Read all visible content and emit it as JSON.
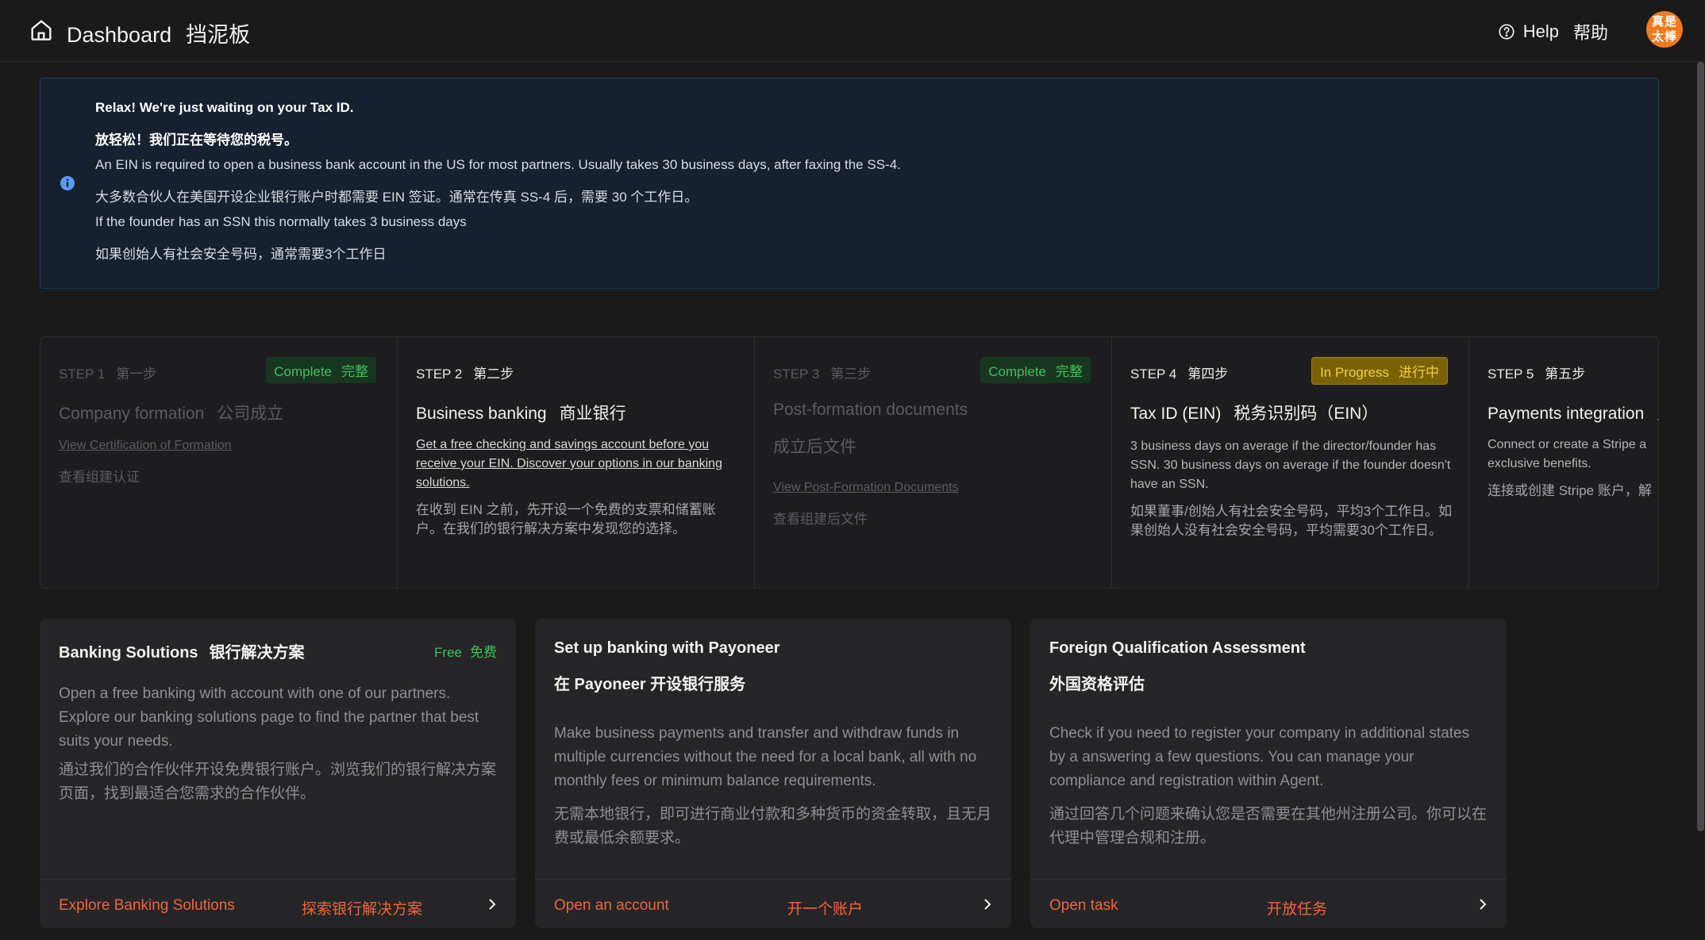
{
  "header": {
    "title": "Dashboard",
    "title_cn": "挡泥板",
    "help": "Help",
    "help_cn": "帮助",
    "avatar_line1": "真是",
    "avatar_line2": "太棒",
    "avatar_color": "#ee7a1e"
  },
  "banner": {
    "heading": "Relax! We're just waiting on your Tax ID.",
    "heading_cn": "放轻松！我们正在等待您的税号。",
    "line1": "An EIN is required to open a business bank account in the US for most partners. Usually takes 30 business days, after faxing the SS-4.",
    "line1_cn": "大多数合伙人在美国开设企业银行账户时都需要 EIN 签证。通常在传真 SS-4 后，需要 30 个工作日。",
    "line2": "If the founder has an SSN this normally takes 3 business days",
    "line2_cn": "如果创始人有社会安全号码，通常需要3个工作日",
    "icon": "info-icon"
  },
  "steps": [
    {
      "num": "STEP 1",
      "num_cn": "第一步",
      "badge": "Complete",
      "badge_cn": "完整",
      "title": "Company formation",
      "title_cn": "公司成立",
      "link": "View Certification of Formation",
      "link_cn": "查看组建认证"
    },
    {
      "num": "STEP 2",
      "num_cn": "第二步",
      "title": "Business banking",
      "title_cn": "商业银行",
      "body": "Get a free checking and savings account before you receive your EIN. Discover your options in our banking solutions.",
      "body_cn": "在收到 EIN 之前，先开设一个免费的支票和储蓄账户。在我们的银行解决方案中发现您的选择。"
    },
    {
      "num": "STEP 3",
      "num_cn": "第三步",
      "badge": "Complete",
      "badge_cn": "完整",
      "title": "Post-formation documents",
      "title_cn": "成立后文件",
      "link": "View Post-Formation Documents",
      "link_cn": "查看组建后文件"
    },
    {
      "num": "STEP 4",
      "num_cn": "第四步",
      "badge": "In Progress",
      "badge_cn": "进行中",
      "title": "Tax ID (EIN)",
      "title_cn": "税务识别码（EIN）",
      "body": "3 business days on average if the director/founder has SSN. 30 business days on average if the founder doesn't have an SSN.",
      "body_cn": "如果董事/创始人有社会安全号码，平均3个工作日。如果创始人没有社会安全号码，平均需要30个工作日。"
    },
    {
      "num": "STEP 5",
      "num_cn": "第五步",
      "title": "Payments integration",
      "title_cn": "支",
      "body": "Connect or create a Stripe a exclusive benefits.",
      "body_cn": "连接或创建 Stripe 账户，解"
    }
  ],
  "cards": [
    {
      "title": "Banking Solutions",
      "title_cn": "银行解决方案",
      "free": "Free",
      "free_cn": "免费",
      "desc": "Open a free banking with account with one of our partners. Explore our banking solutions page to find the partner that best suits your needs.",
      "desc_cn": "通过我们的合作伙伴开设免费银行账户。浏览我们的银行解决方案页面，找到最适合您需求的合作伙伴。",
      "cta": "Explore Banking Solutions",
      "cta_cn": "探索银行解决方案"
    },
    {
      "title": "Set up banking with Payoneer",
      "title_cn": "在 Payoneer 开设银行服务",
      "desc": "Make business payments and transfer and withdraw funds in multiple currencies without the need for a local bank, all with no monthly fees or minimum balance requirements.",
      "desc_cn": "无需本地银行，即可进行商业付款和多种货币的资金转取，且无月费或最低余额要求。",
      "cta": "Open an account",
      "cta_cn": "开一个账户"
    },
    {
      "title": "Foreign Qualification Assessment",
      "title_cn": "外国资格评估",
      "desc": "Check if you need to register your company in additional states by a answering a few questions. You can manage your compliance and registration within Agent.",
      "desc_cn": "通过回答几个问题来确认您是否需要在其他州注册公司。你可以在代理中管理合规和注册。",
      "cta": "Open task",
      "cta_cn": "开放任务"
    }
  ],
  "colors": {
    "accent": "#f2643c",
    "complete": "#3fc15c",
    "in_progress": "#f3cf3a",
    "banner_border": "#223d61"
  }
}
